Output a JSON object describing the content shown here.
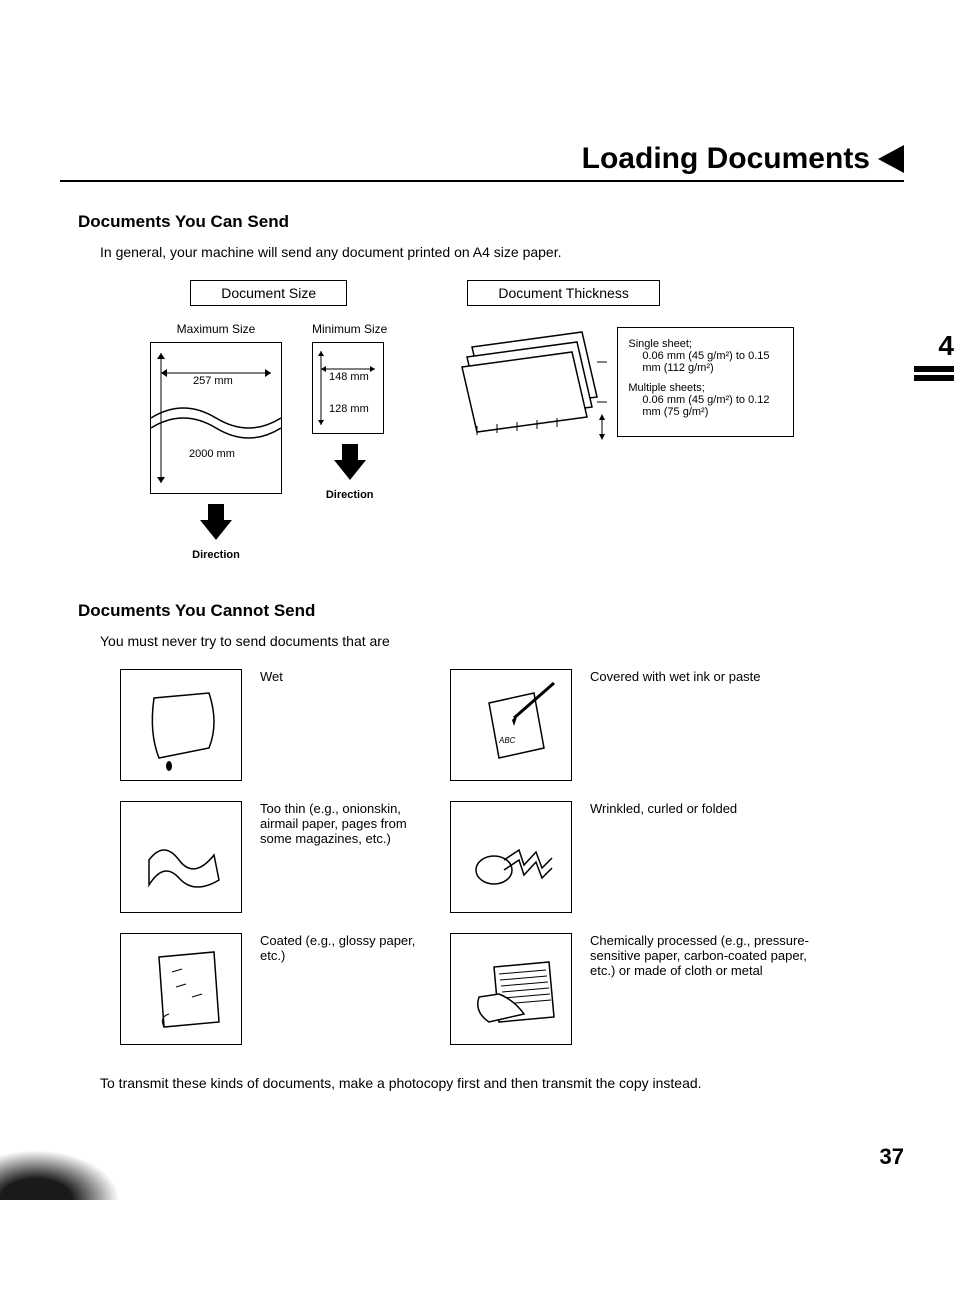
{
  "page_title": "Loading Documents",
  "chapter": "4",
  "page_number": "37",
  "section1": {
    "title": "Documents You Can Send",
    "intro": "In general, your machine will send any document printed on A4 size paper.",
    "doc_size_label": "Document Size",
    "doc_thick_label": "Document Thickness",
    "max_label": "Maximum Size",
    "min_label": "Minimum Size",
    "max_width": "257 mm",
    "max_length": "2000 mm",
    "min_width": "148 mm",
    "min_length": "128 mm",
    "direction": "Direction",
    "single_label": "Single sheet;",
    "single_range": "0.06 mm (45 g/m²) to 0.15 mm (112 g/m²)",
    "multi_label": "Multiple sheets;",
    "multi_range": "0.06 mm (45 g/m²) to 0.12 mm (75 g/m²)"
  },
  "section2": {
    "title": "Documents You Cannot Send",
    "intro": "You must never try to send documents that are",
    "items": {
      "wet": "Wet",
      "wet_ink": "Covered with wet ink or paste",
      "thin": "Too thin (e.g., onionskin, airmail paper, pages from some magazines, etc.)",
      "wrinkled": "Wrinkled, curled or folded",
      "coated": "Coated (e.g., glossy paper, etc.)",
      "chemical": "Chemically processed (e.g., pressure-sensitive paper, carbon-coated paper, etc.) or made of cloth or metal"
    },
    "footer": "To transmit these kinds of documents, make a photocopy first and then transmit the copy instead."
  }
}
